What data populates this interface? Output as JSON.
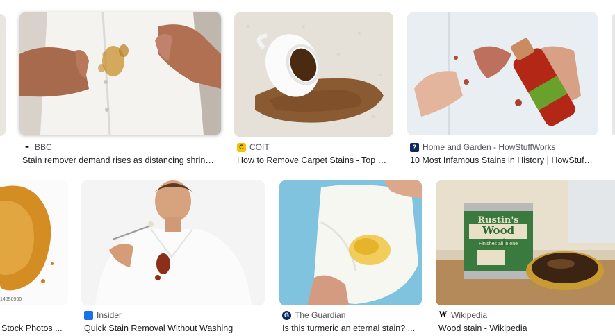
{
  "results": [
    {
      "source": "BBC",
      "title": "Stain remover demand rises as distancing shrinks...",
      "favicon": "bbc-icon",
      "fav_text": "▪▪▪",
      "fav_color": "#ffffff"
    },
    {
      "source": "COIT",
      "title": "How to Remove Carpet Stains - Top 5 ...",
      "favicon": "coit-icon",
      "fav_text": "C",
      "fav_color": "#f2c500"
    },
    {
      "source": "Home and Garden - HowStuffWorks",
      "title": "10 Most Infamous Stains in History | HowStuffWorks",
      "favicon": "howstuffworks-icon",
      "fav_text": "?",
      "fav_color": "#0b2d5b"
    },
    {
      "source": "",
      "title": "Stock Photos ...",
      "favicon": "",
      "fav_text": "",
      "fav_color": "#ffffff"
    },
    {
      "source": "Insider",
      "title": "Quick Stain Removal Without Washing",
      "favicon": "insider-icon",
      "fav_text": "",
      "fav_color": "#1a73e8"
    },
    {
      "source": "The Guardian",
      "title": "Is this turmeric an eternal stain? ...",
      "favicon": "guardian-icon",
      "fav_text": "G",
      "fav_color": "#052962"
    },
    {
      "source": "Wikipedia",
      "title": "Wood stain - Wikipedia",
      "favicon": "wikipedia-icon",
      "fav_text": "W",
      "fav_color": "#ffffff"
    }
  ],
  "stock_watermark": "14858930",
  "wood_stain_can": {
    "brand": "Rustin's",
    "product": "Wood Stain",
    "tagline": "Finishes all in one"
  }
}
